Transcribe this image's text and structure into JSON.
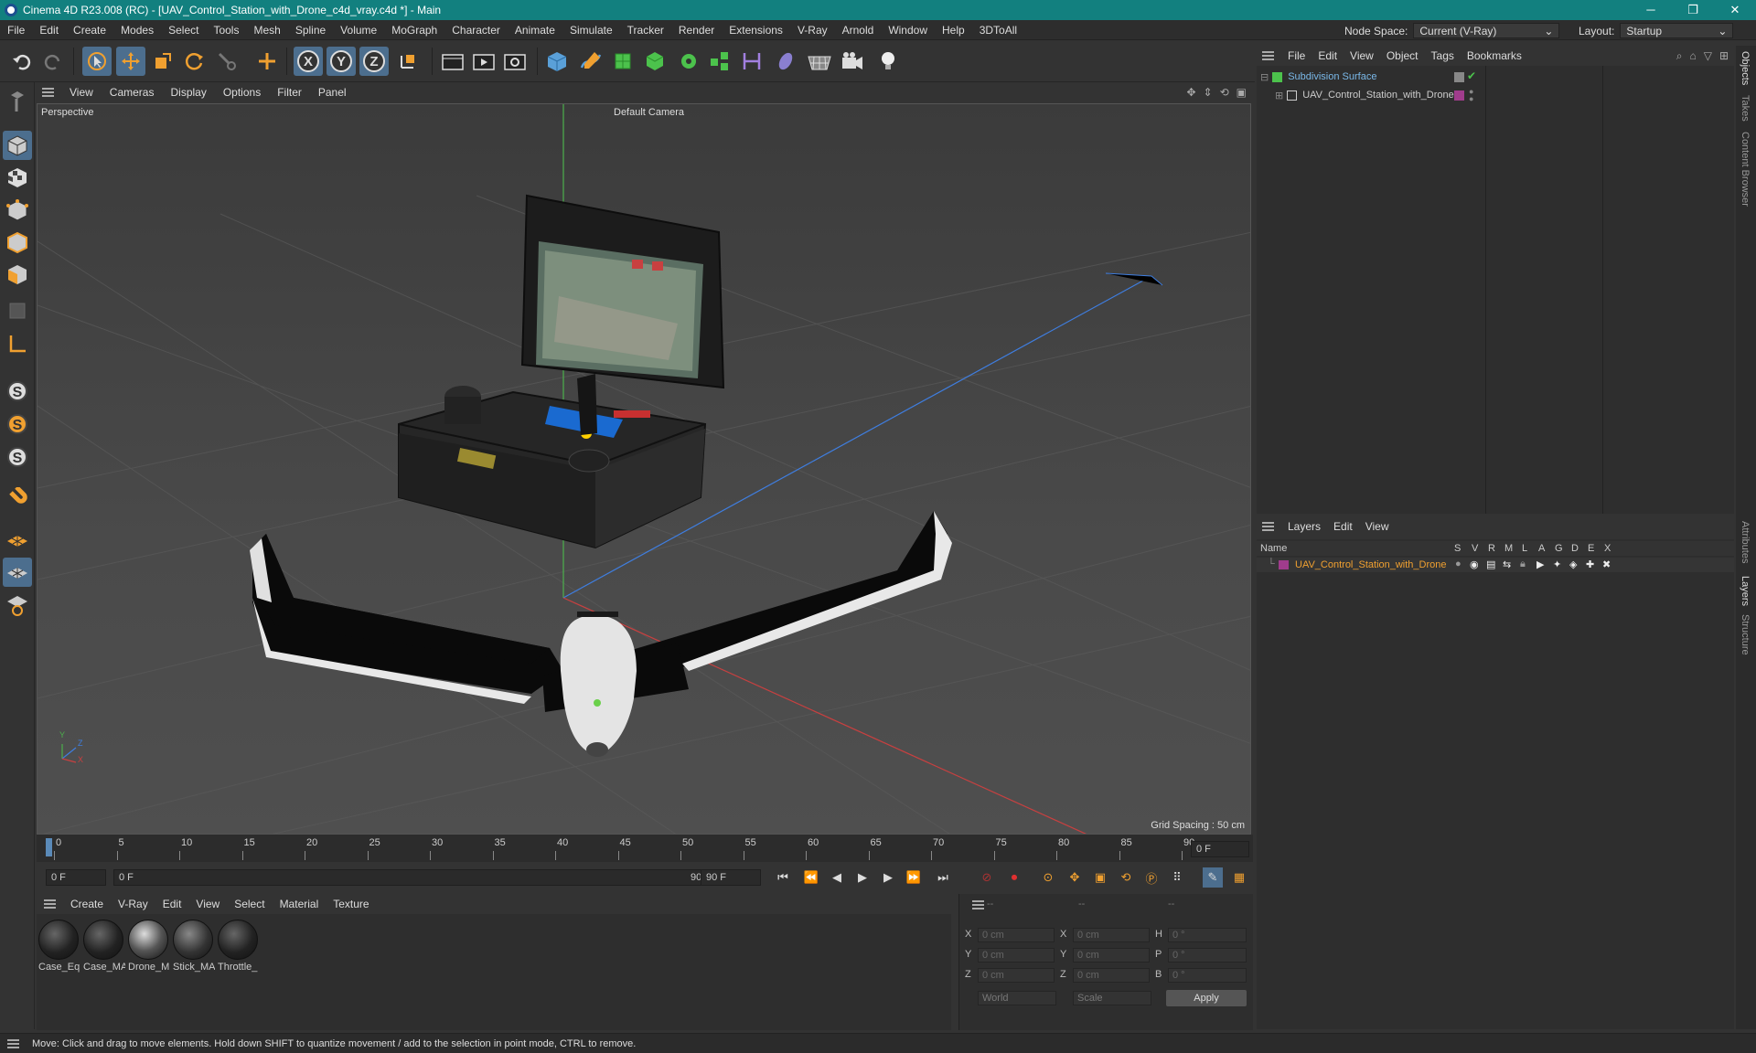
{
  "titlebar": {
    "title": "Cinema 4D R23.008 (RC) - [UAV_Control_Station_with_Drone_c4d_vray.c4d *] - Main",
    "minimize": "─",
    "maximize": "❐",
    "close": "✕"
  },
  "menubar": {
    "items": [
      "File",
      "Edit",
      "Create",
      "Modes",
      "Select",
      "Tools",
      "Mesh",
      "Spline",
      "Volume",
      "MoGraph",
      "Character",
      "Animate",
      "Simulate",
      "Tracker",
      "Render",
      "Extensions",
      "V-Ray",
      "Arnold",
      "Window",
      "Help",
      "3DToAll"
    ],
    "node_space_label": "Node Space:",
    "node_space_value": "Current (V-Ray)",
    "layout_label": "Layout:",
    "layout_value": "Startup"
  },
  "viewport": {
    "menu": [
      "View",
      "Cameras",
      "Display",
      "Options",
      "Filter",
      "Panel"
    ],
    "view_name": "Perspective",
    "camera": "Default Camera",
    "grid_spacing": "Grid Spacing : 50 cm",
    "axis_y": "Y",
    "axis_z": "Z",
    "axis_x": "X"
  },
  "timeline": {
    "ticks": [
      "0",
      "5",
      "10",
      "15",
      "20",
      "25",
      "30",
      "35",
      "40",
      "45",
      "50",
      "55",
      "60",
      "65",
      "70",
      "75",
      "80",
      "85",
      "90"
    ],
    "current_frame_display": "0 F"
  },
  "transport": {
    "start_frame": "0 F",
    "range_start": "0 F",
    "range_end": "90 F",
    "end_frame": "90 F"
  },
  "material_manager": {
    "menu": [
      "Create",
      "V-Ray",
      "Edit",
      "View",
      "Select",
      "Material",
      "Texture"
    ],
    "materials": [
      "Case_Eq",
      "Case_MA",
      "Drone_M",
      "Stick_MA",
      "Throttle_"
    ]
  },
  "coordinates": {
    "header": [
      "--",
      "--",
      "--"
    ],
    "rows": [
      {
        "a": "X",
        "av": "0 cm",
        "b": "X",
        "bv": "0 cm",
        "c": "H",
        "cv": "0 °"
      },
      {
        "a": "Y",
        "av": "0 cm",
        "b": "Y",
        "bv": "0 cm",
        "c": "P",
        "cv": "0 °"
      },
      {
        "a": "Z",
        "av": "0 cm",
        "b": "Z",
        "bv": "0 cm",
        "c": "B",
        "cv": "0 °"
      }
    ],
    "mode_world": "World",
    "mode_scale": "Scale",
    "apply": "Apply"
  },
  "object_manager": {
    "menu": [
      "File",
      "Edit",
      "View",
      "Object",
      "Tags",
      "Bookmarks"
    ],
    "objects": [
      {
        "name": "Subdivision Surface",
        "color": "#7ab8e8"
      },
      {
        "name": "UAV_Control_Station_with_Drone",
        "color": "#cccccc"
      }
    ]
  },
  "layer_manager": {
    "menu": [
      "Layers",
      "Edit",
      "View"
    ],
    "col_name": "Name",
    "columns": [
      "S",
      "V",
      "R",
      "M",
      "L",
      "A",
      "G",
      "D",
      "E",
      "X"
    ],
    "layers": [
      {
        "name": "UAV_Control_Station_with_Drone",
        "color": "#f0a030"
      }
    ]
  },
  "side_tabs": [
    "Objects",
    "Takes",
    "Content Browser",
    "Attributes",
    "Layers",
    "Structure"
  ],
  "status": "Move: Click and drag to move elements. Hold down SHIFT to quantize movement / add to the selection in point mode, CTRL to remove.",
  "colors": {
    "accent": "#12807f",
    "selection": "#4c6e8e",
    "layer_color": "#a03c8c"
  }
}
